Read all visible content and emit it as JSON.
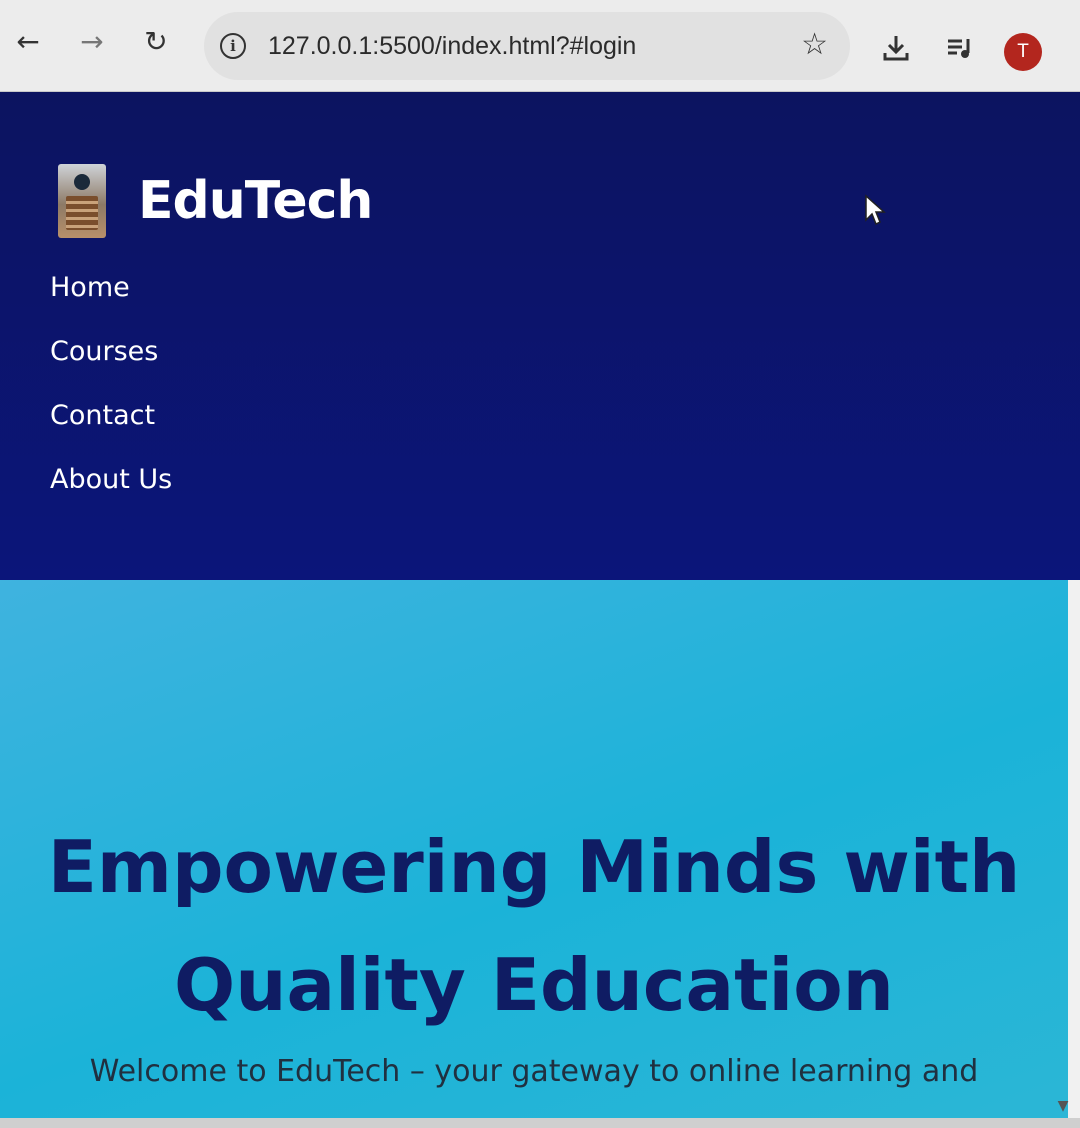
{
  "browser": {
    "url": "127.0.0.1:5500/index.html?#login",
    "profile_initial": "T",
    "icons": {
      "back": "arrow-left-icon",
      "forward": "arrow-right-icon",
      "reload": "reload-icon",
      "site_info": "info-icon",
      "bookmark": "star-icon",
      "downloads": "download-icon",
      "media": "media-queue-icon"
    }
  },
  "site": {
    "brand_name": "EduTech",
    "nav": [
      "Home",
      "Courses",
      "Contact",
      "About Us"
    ]
  },
  "hero": {
    "title": "Empowering Minds with Quality Education",
    "subtitle": "Welcome to EduTech – your gateway to online learning and"
  },
  "colors": {
    "header_bg": "#0b157a",
    "hero_bg": "#1bb3d8",
    "hero_title": "#0f1c63",
    "avatar": "#b3261e"
  }
}
